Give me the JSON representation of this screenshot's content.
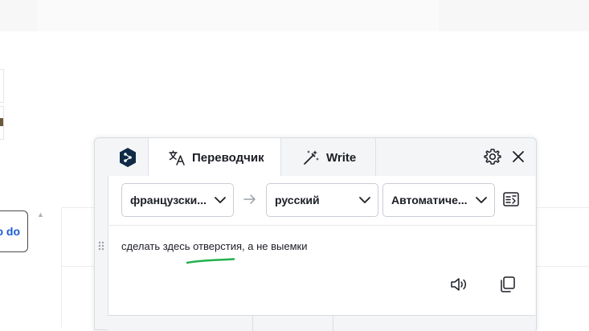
{
  "background": {
    "todo_button_label": "o do"
  },
  "translator": {
    "tabs": [
      {
        "label": "Переводчик",
        "icon": "translate-icon",
        "active": true
      },
      {
        "label": "Write",
        "icon": "magic-wand-icon",
        "active": false
      }
    ],
    "source_language": "французски...",
    "target_language": "русский",
    "mode": "Автоматиче...",
    "source_text": "сделать здесь отверстия, а не выемки",
    "colors": {
      "logo": "#0f2b46",
      "accent_underline": "#22b14c",
      "panel_bg": "#f3f5f7"
    },
    "icons": [
      "settings-gear-icon",
      "close-icon",
      "arrow-right-icon",
      "glossary-icon",
      "speaker-icon",
      "copy-icon",
      "drag-handle-icon"
    ]
  }
}
